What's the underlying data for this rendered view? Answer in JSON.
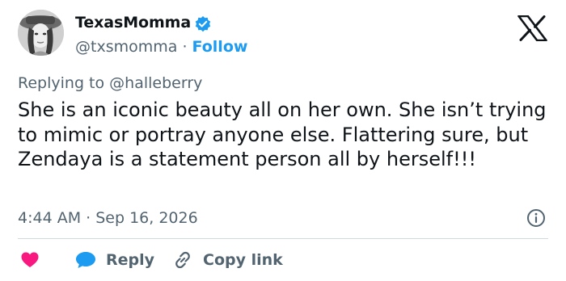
{
  "author": {
    "name": "TexasMomma",
    "handle": "@txsmomma",
    "separator": "·",
    "follow_label": "Follow"
  },
  "brand": {
    "logo": "x-logo-icon"
  },
  "reply_to": "Replying to @halleberry",
  "tweet": {
    "text": "She is an iconic beauty all on her own. She isn’t trying to mimic or portray anyone else. Flattering sure, but Zendaya is a statement person all by herself!!!"
  },
  "meta": {
    "timestamp": "4:44 AM · Sep 16, 2026"
  },
  "actions": {
    "like_icon": "heart-icon",
    "reply_label": "Reply",
    "copy_label": "Copy link"
  },
  "colors": {
    "accent": "#1d9bf0",
    "text": "#0f1419",
    "muted": "#536471",
    "heart": "#f91880",
    "divider": "#cfd9de"
  }
}
